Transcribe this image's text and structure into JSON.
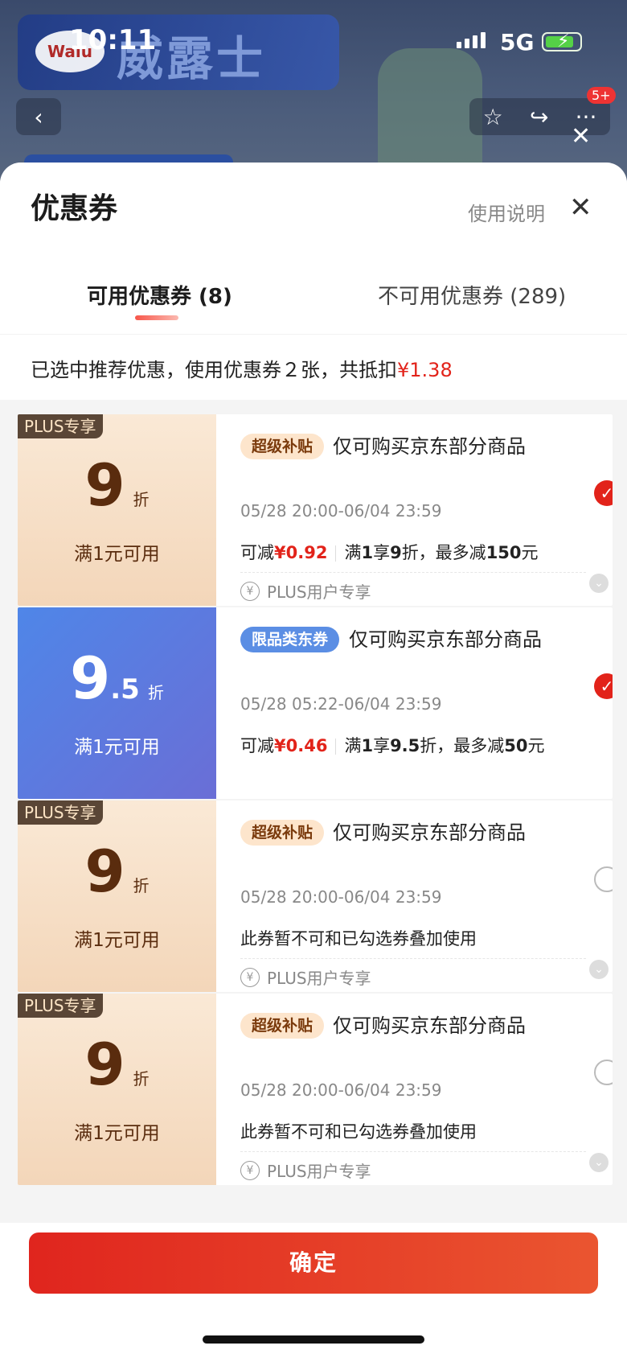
{
  "status_bar": {
    "time": "10:11",
    "network": "5G"
  },
  "background": {
    "brand_logo": "Walu",
    "brand_name": "威露士",
    "cart_badge": "5+"
  },
  "sheet": {
    "title": "优惠券",
    "help_label": "使用说明",
    "tabs": [
      {
        "label": "可用优惠券 (8)",
        "active": true
      },
      {
        "label": "不可用优惠券 (289)",
        "active": false
      }
    ],
    "summary_prefix": "已选中推荐优惠，使用优惠券２张，共抵扣",
    "summary_amount": "¥1.38"
  },
  "coupons": [
    {
      "style": "plus",
      "plus_tag": "PLUS专享",
      "discount_int": "9",
      "discount_dec": "",
      "discount_unit": "折",
      "condition": "满1元可用",
      "tag": "超级补贴",
      "name": "仅可购买京东部分商品",
      "date": "05/28 20:00-06/04 23:59",
      "save_prefix": "可减",
      "save_amount": "¥0.92",
      "rule_prefix": "满",
      "rule_min": "1",
      "rule_mid": "享",
      "rule_disc": "9",
      "rule_suffix": "折，最多减",
      "rule_max": "150",
      "rule_unit": "元",
      "note": "",
      "footer": "PLUS用户专享",
      "checked": true
    },
    {
      "style": "blue",
      "plus_tag": "",
      "discount_int": "9",
      "discount_dec": ".5",
      "discount_unit": "折",
      "condition": "满1元可用",
      "tag": "限品类东券",
      "name": "仅可购买京东部分商品",
      "date": "05/28 05:22-06/04 23:59",
      "save_prefix": "可减",
      "save_amount": "¥0.46",
      "rule_prefix": "满",
      "rule_min": "1",
      "rule_mid": "享",
      "rule_disc": "9.5",
      "rule_suffix": "折，最多减",
      "rule_max": "50",
      "rule_unit": "元",
      "note": "",
      "footer": "",
      "checked": true
    },
    {
      "style": "plus",
      "plus_tag": "PLUS专享",
      "discount_int": "9",
      "discount_dec": "",
      "discount_unit": "折",
      "condition": "满1元可用",
      "tag": "超级补贴",
      "name": "仅可购买京东部分商品",
      "date": "05/28 20:00-06/04 23:59",
      "note": "此券暂不可和已勾选券叠加使用",
      "footer": "PLUS用户专享",
      "checked": false
    },
    {
      "style": "plus",
      "plus_tag": "PLUS专享",
      "discount_int": "9",
      "discount_dec": "",
      "discount_unit": "折",
      "condition": "满1元可用",
      "tag": "超级补贴",
      "name": "仅可购买京东部分商品",
      "date": "05/28 20:00-06/04 23:59",
      "note": "此券暂不可和已勾选券叠加使用",
      "footer": "PLUS用户专享",
      "checked": false
    }
  ],
  "confirm_label": "确定",
  "icons": {
    "back": "back-icon",
    "star": "star-icon",
    "share": "share-icon",
    "more": "more-icon",
    "close": "close-icon",
    "yen": "yen-icon",
    "chevron": "chevron-down-icon",
    "check": "check-icon"
  },
  "colors": {
    "accent_red": "#e2231a",
    "plus_bg": "#f3d6b9",
    "blue_coupon": "#5b7fe0"
  }
}
